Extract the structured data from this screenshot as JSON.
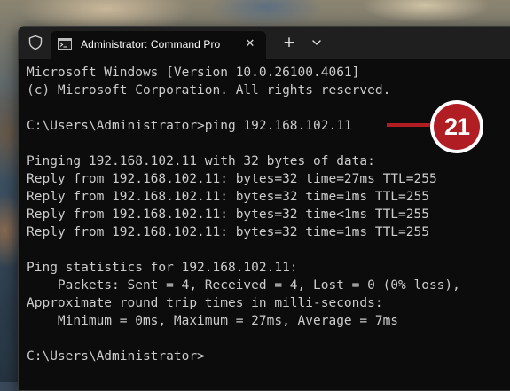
{
  "window": {
    "tab_title": "Administrator: Command Pro",
    "icons": {
      "shield": "shield-icon",
      "tab": "command-prompt-icon",
      "close": "close-icon",
      "new_tab": "plus-icon",
      "dropdown": "chevron-down-icon"
    },
    "new_tab_label": "+",
    "close_label": "✕"
  },
  "terminal": {
    "lines": [
      "Microsoft Windows [Version 10.0.26100.4061]",
      "(c) Microsoft Corporation. All rights reserved.",
      "",
      "C:\\Users\\Administrator>ping 192.168.102.11",
      "",
      "Pinging 192.168.102.11 with 32 bytes of data:",
      "Reply from 192.168.102.11: bytes=32 time=27ms TTL=255",
      "Reply from 192.168.102.11: bytes=32 time=1ms TTL=255",
      "Reply from 192.168.102.11: bytes=32 time<1ms TTL=255",
      "Reply from 192.168.102.11: bytes=32 time=1ms TTL=255",
      "",
      "Ping statistics for 192.168.102.11:",
      "    Packets: Sent = 4, Received = 4, Lost = 0 (0% loss),",
      "Approximate round trip times in milli-seconds:",
      "    Minimum = 0ms, Maximum = 27ms, Average = 7ms",
      "",
      "C:\\Users\\Administrator>"
    ]
  },
  "callout": {
    "number": "21"
  },
  "colors": {
    "terminal_bg": "#0c0c0c",
    "terminal_text": "#cccccc",
    "titlebar_bg": "#1f1f1f",
    "callout_red": "#b01e24"
  }
}
